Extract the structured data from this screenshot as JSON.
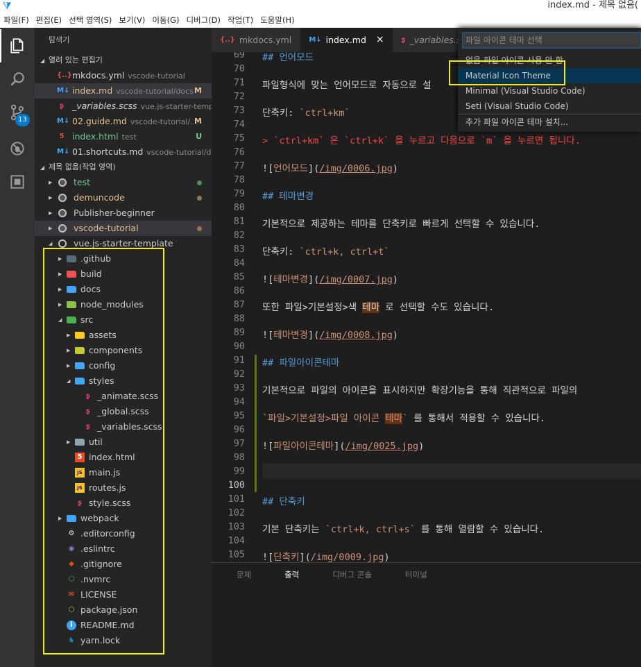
{
  "window": {
    "title": "index.md - 제목 없음("
  },
  "menu": [
    "파일(F)",
    "편집(E)",
    "선택 영역(S)",
    "보기(V)",
    "이동(G)",
    "디버그(D)",
    "작업(T)",
    "도움말(H)"
  ],
  "activity": {
    "scm_badge": "13"
  },
  "explorer": {
    "title": "탐색기",
    "open_editors_label": "열려 있는 편집기",
    "open_editors": [
      {
        "name": "mkdocs.yml",
        "desc": "vscode-tutorial",
        "status": "",
        "icon": "{..}",
        "color": "#e54d4d"
      },
      {
        "name": "index.md",
        "desc": "vscode-tutorial/docs",
        "status": "M",
        "icon": "M↓",
        "color": "#42a5f5"
      },
      {
        "name": "_variables.scss",
        "desc": "vue.js-starter-templa...",
        "status": "",
        "icon": "ʂ",
        "color": "#ec407a"
      },
      {
        "name": "02.guide.md",
        "desc": "vscode-tutorial/...",
        "status": "M",
        "icon": "M↓",
        "color": "#42a5f5"
      },
      {
        "name": "index.html",
        "desc": "test",
        "status": "U",
        "icon": "5",
        "color": "#e44d26"
      },
      {
        "name": "01.shortcuts.md",
        "desc": "vscode-tutorial/do...",
        "status": "",
        "icon": "M↓",
        "color": "#42a5f5"
      }
    ],
    "workspace_label": "제목 없음(작업 영역)",
    "roots": [
      {
        "name": "test",
        "color": "#73c991",
        "dot": "#5a8a5a"
      },
      {
        "name": "demuncode",
        "color": "#e2c08d",
        "dot": "#8c7a55"
      },
      {
        "name": "Publisher-beginner",
        "color": "#cccccc",
        "dot": ""
      },
      {
        "name": "vscode-tutorial",
        "color": "#e2c08d",
        "dot": "#8c7a55"
      },
      {
        "name": "vue.js-starter-template",
        "color": "#cccccc",
        "dot": ""
      }
    ],
    "tree": [
      {
        "name": ".github",
        "icon": "folder",
        "fc": "#546e7a",
        "twisty": "▶"
      },
      {
        "name": "build",
        "icon": "folder",
        "fc": "#ef5350",
        "twisty": "▶"
      },
      {
        "name": "docs",
        "icon": "folder",
        "fc": "#42a5f5",
        "twisty": "▶"
      },
      {
        "name": "node_modules",
        "icon": "folder",
        "fc": "#8bc34a",
        "twisty": "▶"
      },
      {
        "name": "src",
        "icon": "folder",
        "fc": "#4caf50",
        "twisty": "◢"
      },
      {
        "name": "assets",
        "icon": "folder",
        "fc": "#ffca28",
        "twisty": "▶"
      },
      {
        "name": "components",
        "icon": "folder",
        "fc": "#c0ca33",
        "twisty": "▶"
      },
      {
        "name": "config",
        "icon": "folder",
        "fc": "#42a5f5",
        "twisty": "▶"
      },
      {
        "name": "styles",
        "icon": "folder",
        "fc": "#42a5f5",
        "twisty": "◢"
      },
      {
        "name": "_animate.scss",
        "icon": "ʂ",
        "fc": "#ec407a",
        "twisty": ""
      },
      {
        "name": "_global.scss",
        "icon": "ʂ",
        "fc": "#ec407a",
        "twisty": ""
      },
      {
        "name": "_variables.scss",
        "icon": "ʂ",
        "fc": "#ec407a",
        "twisty": ""
      },
      {
        "name": "util",
        "icon": "folder",
        "fc": "#90a4ae",
        "twisty": "▶"
      },
      {
        "name": "index.html",
        "icon": "5",
        "fc": "#e44d26",
        "twisty": ""
      },
      {
        "name": "main.js",
        "icon": "JS",
        "fc": "#fbc02d",
        "twisty": ""
      },
      {
        "name": "routes.js",
        "icon": "JS",
        "fc": "#fbc02d",
        "twisty": ""
      },
      {
        "name": "style.scss",
        "icon": "ʂ",
        "fc": "#ec407a",
        "twisty": ""
      },
      {
        "name": "webpack",
        "icon": "folder",
        "fc": "#42a5f5",
        "twisty": "▶"
      },
      {
        "name": ".editorconfig",
        "icon": "⚙",
        "fc": "#eeeeee",
        "twisty": ""
      },
      {
        "name": ".eslintrc",
        "icon": "◉",
        "fc": "#7986cb",
        "twisty": ""
      },
      {
        "name": ".gitignore",
        "icon": "◆",
        "fc": "#e64a19",
        "twisty": ""
      },
      {
        "name": ".nvmrc",
        "icon": "⬡",
        "fc": "#4caf50",
        "twisty": ""
      },
      {
        "name": "LICENSE",
        "icon": "✉",
        "fc": "#ff5722",
        "twisty": ""
      },
      {
        "name": "package.json",
        "icon": "⬡",
        "fc": "#8bc34a",
        "twisty": ""
      },
      {
        "name": "README.md",
        "icon": "i",
        "fc": "#42a5f5",
        "twisty": ""
      },
      {
        "name": "yarn.lock",
        "icon": "♞",
        "fc": "#2188b6",
        "twisty": ""
      }
    ]
  },
  "tabs": [
    {
      "label": "mkdocs.yml",
      "icon": "{..}",
      "color": "#e54d4d"
    },
    {
      "label": "index.md",
      "icon": "M↓",
      "color": "#42a5f5",
      "close": "×"
    },
    {
      "label": "_variables.scss",
      "icon": "ʂ",
      "color": "#ec407a"
    }
  ],
  "editor": {
    "line_numbers": [
      "69",
      "70",
      "71",
      "72",
      "73",
      "74",
      "75",
      "76",
      "77",
      "78",
      "79",
      "80",
      "81",
      "82",
      "83",
      "84",
      "85",
      "86",
      "87",
      "88",
      "89",
      "90",
      "91",
      "92",
      "93",
      "94",
      "95",
      "96",
      "97",
      "98",
      "99",
      "100",
      "101",
      "102",
      "103",
      "104",
      "105"
    ],
    "lines": {
      "l69": "## 언어모드",
      "l71": "파일형식에 맞는 언어모드로 자동으로 설",
      "l73a": "단축키: ",
      "l73b": "`ctrl+km`",
      "l75": "> `ctrl+km` 은 `ctrl+k` 을 누르고 다음으로 `m` 을 누르면 됩니다.",
      "l77a": "![",
      "l77b": "언어모드",
      "l77c": "](",
      "l77d": "/img/0006.jpg",
      "l77e": ")",
      "l79": "## 테마변경",
      "l81": "기본적으로 제공하는 테마를 단축키로 빠르게 선택할 수 있습니다.",
      "l83a": "단축키: ",
      "l83b": "`ctrl+k, ctrl+t`",
      "l85b": "테마변경",
      "l85d": "/img/0007.jpg",
      "l87a": "또한 파일>기본설정>색 ",
      "l87b": "테마",
      "l87c": " 로 선택할 수도 있습니다.",
      "l89b": "테마변경",
      "l89d": "/img/0008.jpg",
      "l91": "## 파일아이콘테마",
      "l93": "기본적으로 파일의 아이콘을 표시하지만 확장기능을 통해 직관적으로 파일의",
      "l95a": "`파일>기본설정>파일 아이콘 ",
      "l95b": "테마",
      "l95c": "`",
      "l95d": " 를 통해서 적용할 수 있습니다.",
      "l97b": "파일아이콘테마",
      "l97d": "/img/0025.jpg",
      "l101": "## 단축키",
      "l103a": "기본 단축키는 ",
      "l103b": "`ctrl+k, ctrl+s`",
      "l103c": " 를 통해 열람할 수 있습니다.",
      "l105b": "단축키",
      "l105d": "/img/0009.jpg"
    }
  },
  "panel": {
    "tabs": [
      "문제",
      "출력",
      "디버그 콘솔",
      "터미널"
    ]
  },
  "quickpick": {
    "placeholder": "파일 아이콘 테마 선택",
    "items": [
      "없음 파일 아이콘 사용 안 함",
      "Material Icon Theme",
      "Minimal (Visual Studio Code)",
      "Seti (Visual Studio Code)",
      "추가 파일 아이콘 테마 설치..."
    ]
  },
  "colors": {
    "highlight_box": "#f5f000",
    "accent": "#007acc"
  }
}
